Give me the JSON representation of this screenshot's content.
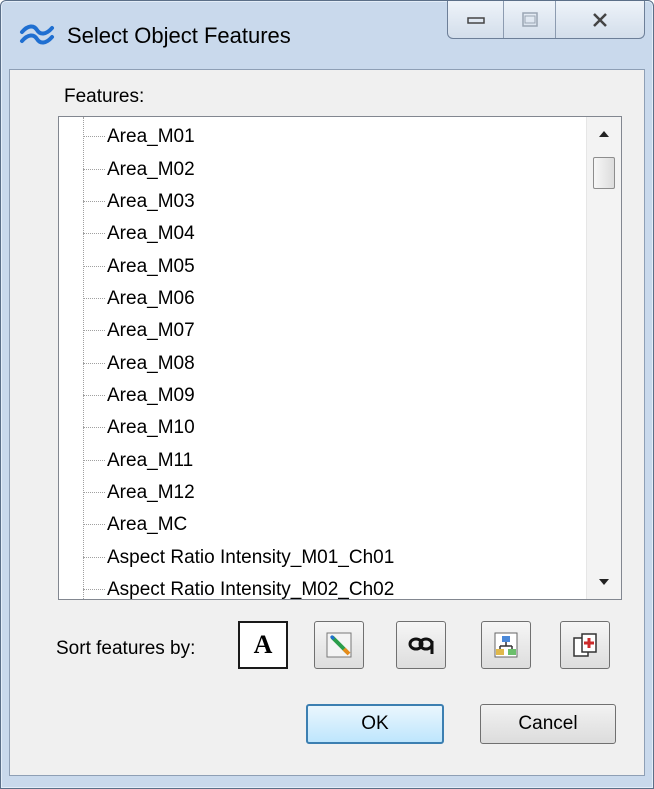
{
  "window": {
    "title": "Select Object Features"
  },
  "features_label": "Features:",
  "features": [
    "Area_M01",
    "Area_M02",
    "Area_M03",
    "Area_M04",
    "Area_M05",
    "Area_M06",
    "Area_M07",
    "Area_M08",
    "Area_M09",
    "Area_M10",
    "Area_M11",
    "Area_M12",
    "Area_MC",
    "Aspect Ratio Intensity_M01_Ch01",
    "Aspect Ratio Intensity_M02_Ch02"
  ],
  "sort": {
    "label": "Sort features by:",
    "buttons": [
      {
        "icon": "alphabetical-sort-icon",
        "glyph": "A",
        "pressed": true
      },
      {
        "icon": "pencil-sort-icon",
        "pressed": false
      },
      {
        "icon": "mask-sort-icon",
        "pressed": false
      },
      {
        "icon": "hierarchy-sort-icon",
        "pressed": false
      },
      {
        "icon": "channel-sort-icon",
        "pressed": false
      }
    ]
  },
  "buttons": {
    "ok": "OK",
    "cancel": "Cancel"
  }
}
